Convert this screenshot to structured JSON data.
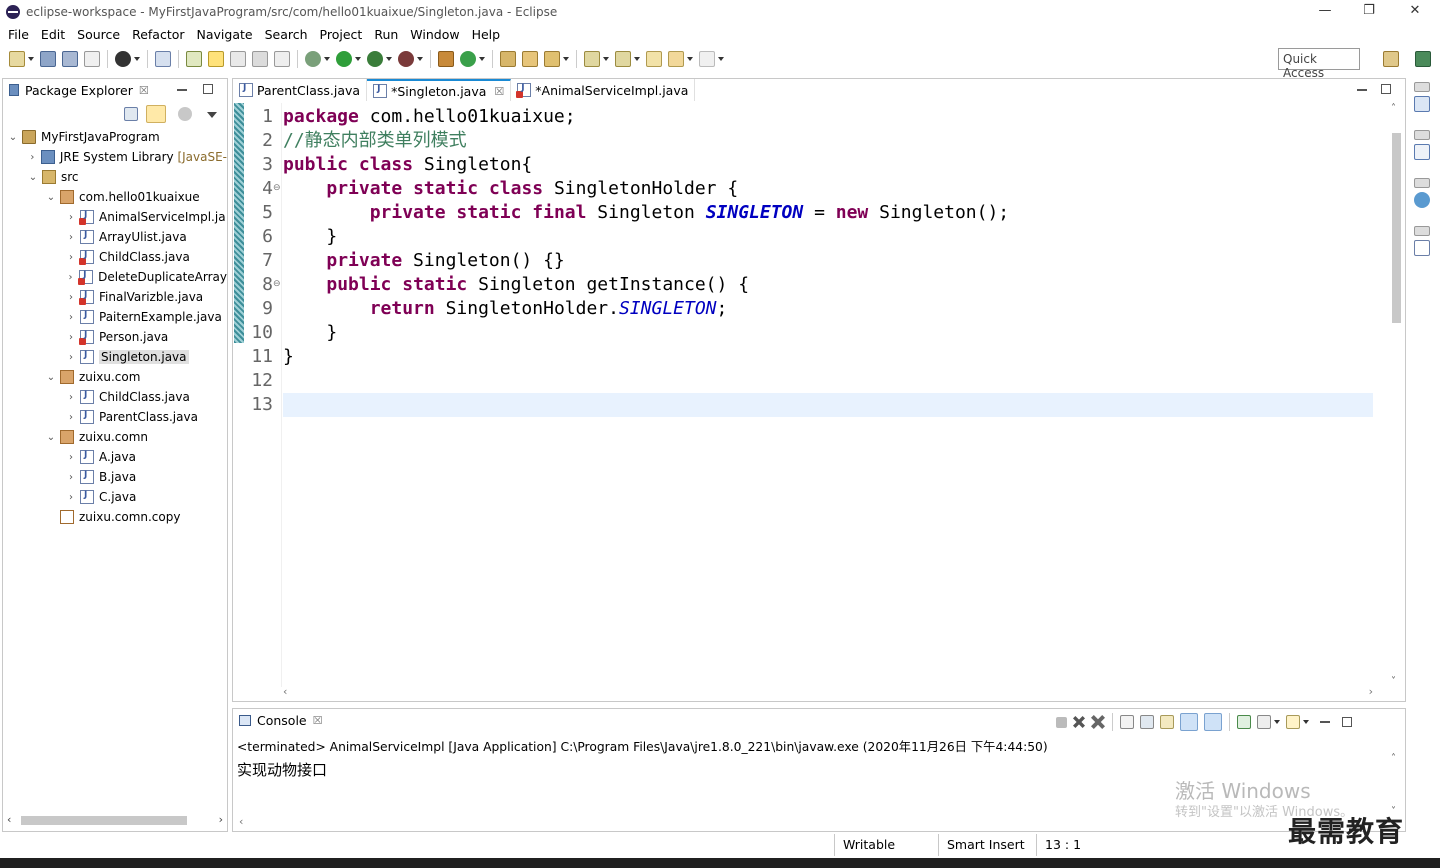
{
  "window": {
    "title": "eclipse-workspace - MyFirstJavaProgram/src/com/hello01kuaixue/Singleton.java - Eclipse",
    "minimize": "—",
    "restore": "❐",
    "close": "✕"
  },
  "menu": [
    "File",
    "Edit",
    "Source",
    "Refactor",
    "Navigate",
    "Search",
    "Project",
    "Run",
    "Window",
    "Help"
  ],
  "toolbar": {
    "quick_access": "Quick Access"
  },
  "package_explorer": {
    "title": "Package Explorer",
    "close": "☒",
    "tree": [
      {
        "label": "MyFirstJavaProgram",
        "deco": "",
        "depth": 0,
        "expanded": "down",
        "icon": "project"
      },
      {
        "label": "JRE System Library",
        "deco": " [JavaSE-",
        "depth": 1,
        "expanded": "right",
        "icon": "library"
      },
      {
        "label": "src",
        "deco": "",
        "depth": 1,
        "expanded": "down",
        "icon": "source-folder"
      },
      {
        "label": "com.hello01kuaixue",
        "deco": "",
        "depth": 2,
        "expanded": "down",
        "icon": "package"
      },
      {
        "label": "AnimalServiceImpl.ja",
        "deco": "",
        "depth": 3,
        "expanded": "right",
        "icon": "java-error"
      },
      {
        "label": "ArrayUlist.java",
        "deco": "",
        "depth": 3,
        "expanded": "right",
        "icon": "java"
      },
      {
        "label": "ChildClass.java",
        "deco": "",
        "depth": 3,
        "expanded": "right",
        "icon": "java-error"
      },
      {
        "label": "DeleteDuplicateArray",
        "deco": "",
        "depth": 3,
        "expanded": "right",
        "icon": "java-error"
      },
      {
        "label": "FinalVarizble.java",
        "deco": "",
        "depth": 3,
        "expanded": "right",
        "icon": "java-error"
      },
      {
        "label": "PaiternExample.java",
        "deco": "",
        "depth": 3,
        "expanded": "right",
        "icon": "java"
      },
      {
        "label": "Person.java",
        "deco": "",
        "depth": 3,
        "expanded": "right",
        "icon": "java-error"
      },
      {
        "label": "Singleton.java",
        "deco": "",
        "depth": 3,
        "expanded": "right",
        "icon": "java",
        "selected": true
      },
      {
        "label": "zuixu.com",
        "deco": "",
        "depth": 2,
        "expanded": "down",
        "icon": "package"
      },
      {
        "label": "ChildClass.java",
        "deco": "",
        "depth": 3,
        "expanded": "right",
        "icon": "java"
      },
      {
        "label": "ParentClass.java",
        "deco": "",
        "depth": 3,
        "expanded": "right",
        "icon": "java"
      },
      {
        "label": "zuixu.comn",
        "deco": "",
        "depth": 2,
        "expanded": "down",
        "icon": "package"
      },
      {
        "label": "A.java",
        "deco": "",
        "depth": 3,
        "expanded": "right",
        "icon": "java"
      },
      {
        "label": "B.java",
        "deco": "",
        "depth": 3,
        "expanded": "right",
        "icon": "java"
      },
      {
        "label": "C.java",
        "deco": "",
        "depth": 3,
        "expanded": "right",
        "icon": "java"
      },
      {
        "label": "zuixu.comn.copy",
        "deco": "",
        "depth": 2,
        "expanded": "",
        "icon": "package-empty"
      }
    ]
  },
  "editor": {
    "tabs": [
      {
        "label": "ParentClass.java",
        "active": false,
        "close": ""
      },
      {
        "label": "*Singleton.java",
        "active": true,
        "close": "☒"
      },
      {
        "label": "*AnimalServiceImpl.java",
        "active": false,
        "close": ""
      }
    ],
    "line_numbers": [
      "1",
      "2",
      "3",
      "4",
      "5",
      "6",
      "7",
      "8",
      "9",
      "10",
      "11",
      "12",
      "13"
    ],
    "code_lines": [
      [
        {
          "t": "package",
          "c": "kw"
        },
        {
          "t": " com.hello01kuaixue;",
          "c": ""
        }
      ],
      [
        {
          "t": "//静态内部类单列模式",
          "c": "cm"
        }
      ],
      [
        {
          "t": "public",
          "c": "kw"
        },
        {
          "t": " ",
          "c": ""
        },
        {
          "t": "class",
          "c": "kw"
        },
        {
          "t": " Singleton{",
          "c": ""
        }
      ],
      [
        {
          "t": "    ",
          "c": ""
        },
        {
          "t": "private",
          "c": "kw"
        },
        {
          "t": " ",
          "c": ""
        },
        {
          "t": "static",
          "c": "kw"
        },
        {
          "t": " ",
          "c": ""
        },
        {
          "t": "class",
          "c": "kw"
        },
        {
          "t": " SingletonHolder {",
          "c": ""
        }
      ],
      [
        {
          "t": "        ",
          "c": ""
        },
        {
          "t": "private",
          "c": "kw"
        },
        {
          "t": " ",
          "c": ""
        },
        {
          "t": "static",
          "c": "kw"
        },
        {
          "t": " ",
          "c": ""
        },
        {
          "t": "final",
          "c": "kw"
        },
        {
          "t": " Singleton ",
          "c": ""
        },
        {
          "t": "SINGLETON",
          "c": "fld"
        },
        {
          "t": " = ",
          "c": ""
        },
        {
          "t": "new",
          "c": "kw"
        },
        {
          "t": " Singleton();",
          "c": ""
        }
      ],
      [
        {
          "t": "    }",
          "c": ""
        }
      ],
      [
        {
          "t": "    ",
          "c": ""
        },
        {
          "t": "private",
          "c": "kw"
        },
        {
          "t": " Singleton() {}",
          "c": ""
        }
      ],
      [
        {
          "t": "    ",
          "c": ""
        },
        {
          "t": "public",
          "c": "kw"
        },
        {
          "t": " ",
          "c": ""
        },
        {
          "t": "static",
          "c": "kw"
        },
        {
          "t": " Singleton getInstance() {",
          "c": ""
        }
      ],
      [
        {
          "t": "        ",
          "c": ""
        },
        {
          "t": "return",
          "c": "kw"
        },
        {
          "t": " SingletonHolder.",
          "c": ""
        },
        {
          "t": "SINGLETON",
          "c": "fld2"
        },
        {
          "t": ";",
          "c": ""
        }
      ],
      [
        {
          "t": "    }",
          "c": ""
        }
      ],
      [
        {
          "t": "}",
          "c": ""
        }
      ],
      [
        {
          "t": "",
          "c": ""
        }
      ],
      [
        {
          "t": "",
          "c": ""
        }
      ]
    ]
  },
  "console": {
    "title": "Console",
    "close": "☒",
    "terminated": "<terminated> AnimalServiceImpl [Java Application] C:\\Program Files\\Java\\jre1.8.0_221\\bin\\javaw.exe (2020年11月26日 下午4:44:50)",
    "output": "实现动物接口"
  },
  "overlay": {
    "activate_title": "激活 Windows",
    "activate_hint": "转到\"设置\"以激活 Windows。",
    "brand": "最需教育"
  },
  "status": {
    "writable": "Writable",
    "insert_mode": "Smart Insert",
    "position": "13 : 1"
  },
  "colors": {
    "keyword": "#7f0055",
    "comment": "#3f7f5f",
    "static_field": "#0000c0",
    "active_tab": "#1a8ad4"
  }
}
